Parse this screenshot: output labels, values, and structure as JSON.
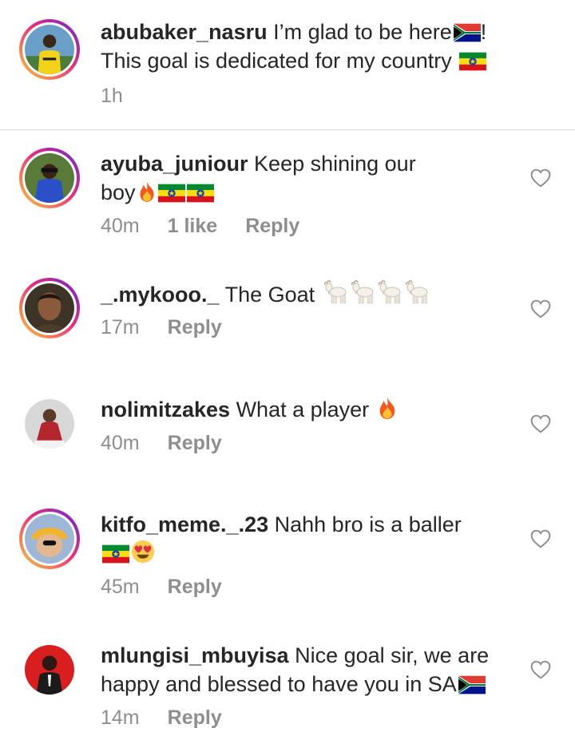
{
  "caption": {
    "username": "abubaker_nasru",
    "text": "I’m glad to be here",
    "text_after": "!",
    "line2": "This goal is dedicated for my country",
    "time": "1h"
  },
  "comments": [
    {
      "username": "ayuba_juniour",
      "text": "Keep shining our",
      "line2": "boy",
      "time": "40m",
      "likes": "1 like",
      "reply": "Reply"
    },
    {
      "username": "_.mykooo._",
      "text": "The Goat",
      "time": "17m",
      "reply": "Reply"
    },
    {
      "username": "nolimitzakes",
      "text": "What a player",
      "time": "40m",
      "reply": "Reply"
    },
    {
      "username": "kitfo_meme._.23",
      "text": "Nahh bro is a baller",
      "time": "45m",
      "reply": "Reply"
    },
    {
      "username": "mlungisi_mbuyisa",
      "text": "Nice goal sir, we are",
      "line2": "happy and blessed to have you in SA",
      "time": "14m",
      "reply": "Reply"
    }
  ],
  "icons": {
    "like": "heart-outline-icon",
    "sa_flag": "south-africa-flag-emoji",
    "eth_flag": "ethiopia-flag-emoji",
    "fire": "fire-emoji",
    "goat": "goat-emoji",
    "heart_eyes": "heart-eyes-emoji"
  },
  "colors": {
    "text": "#262626",
    "meta": "#8e8e8e",
    "divider": "#dbdbdb",
    "story_ring_start": "#f9ce34",
    "story_ring_end": "#6228d7"
  }
}
